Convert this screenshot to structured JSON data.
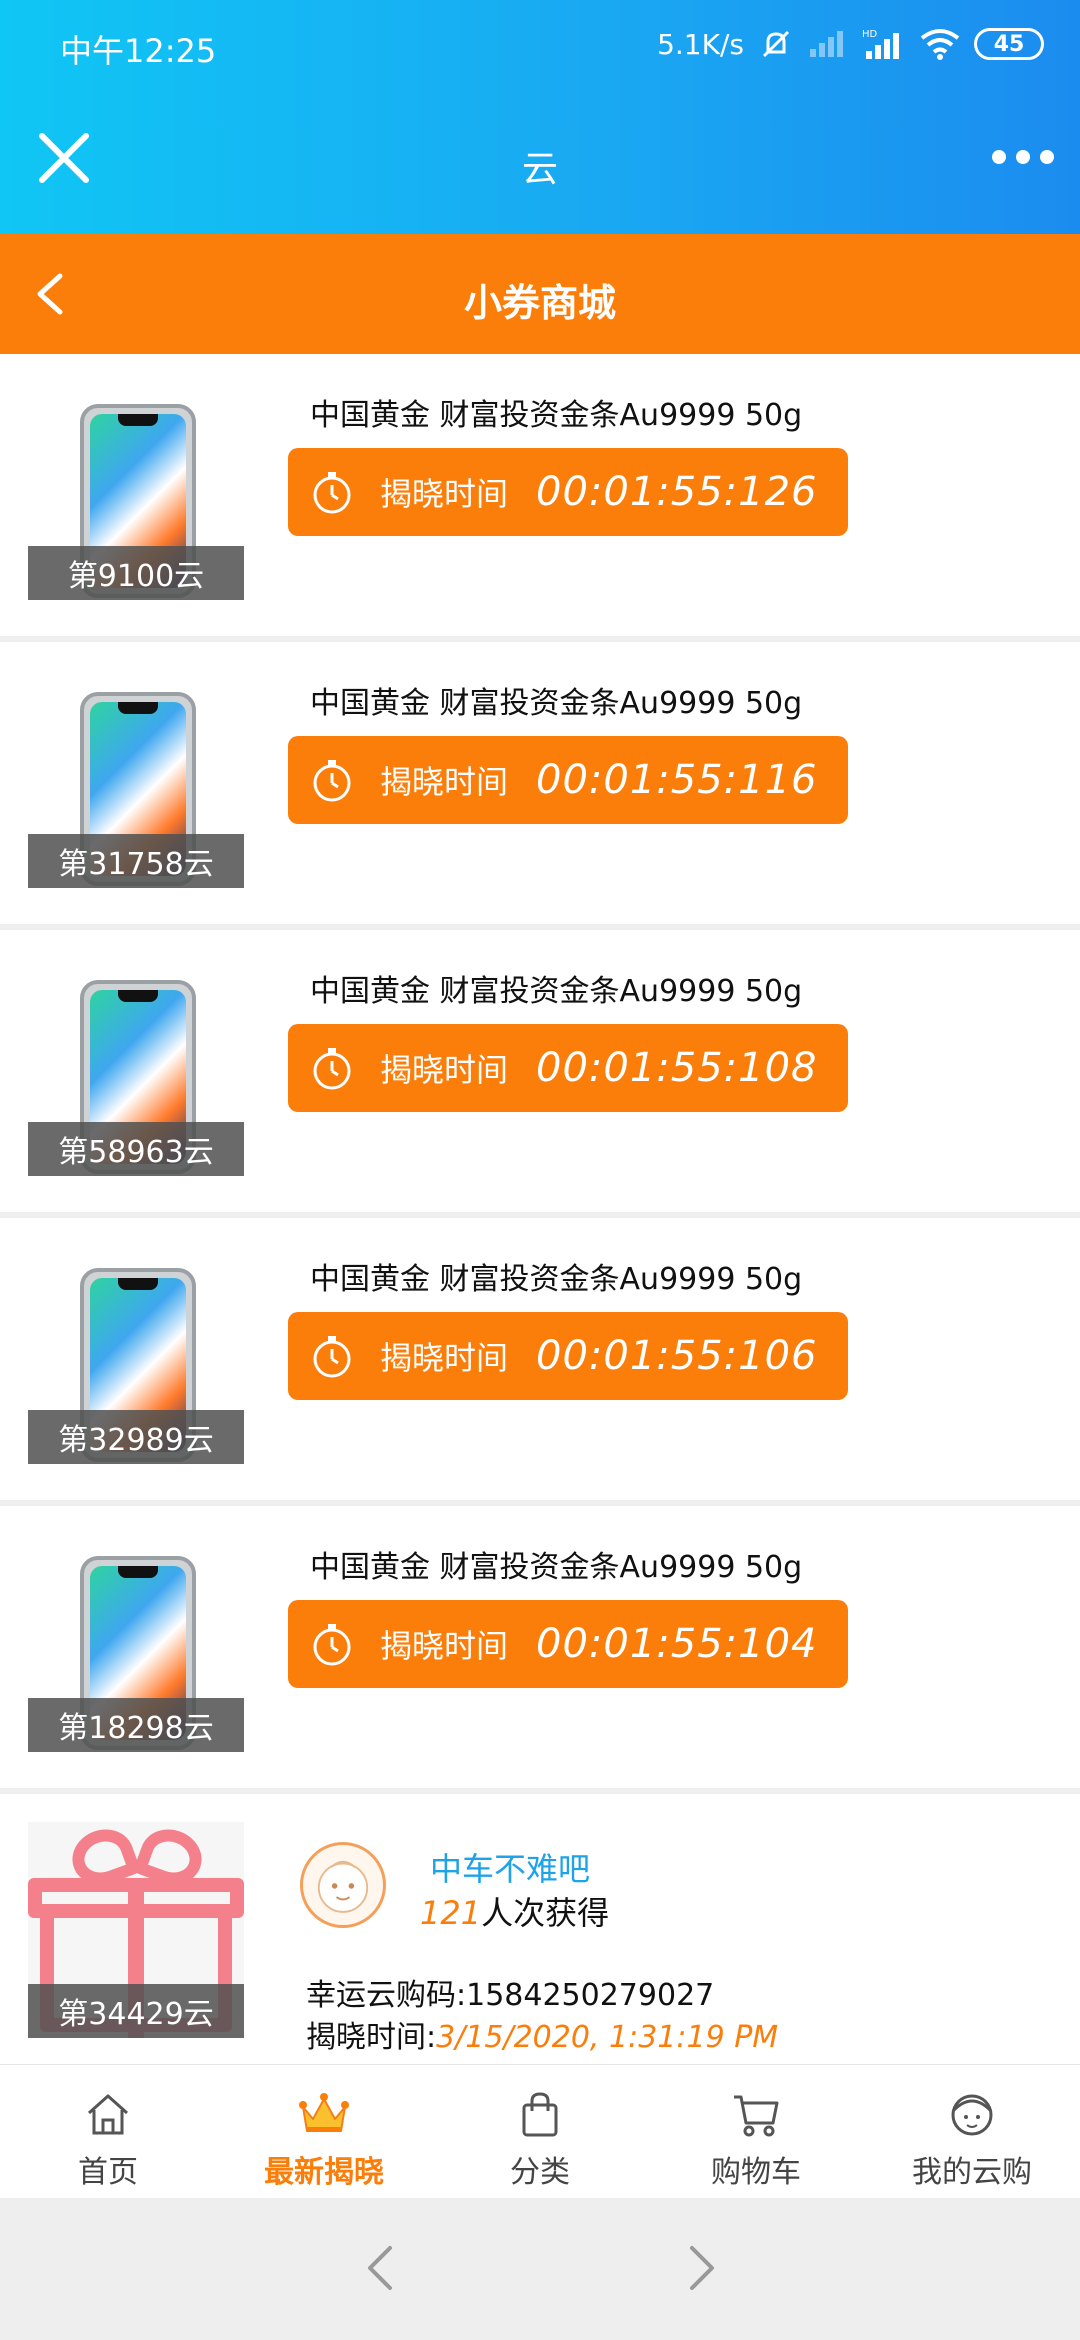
{
  "status_bar": {
    "time": "中午12:25",
    "network_speed": "5.1K/s",
    "battery": "45",
    "hd": "HD"
  },
  "titlebar": {
    "title": "云"
  },
  "header": {
    "title": "小券商城"
  },
  "countdown_label": "揭晓时间",
  "items": [
    {
      "round": "第9100云",
      "title": "中国黄金 财富投资金条Au9999 50g",
      "countdown": "00:01:55:126"
    },
    {
      "round": "第31758云",
      "title": "中国黄金 财富投资金条Au9999 50g",
      "countdown": "00:01:55:116"
    },
    {
      "round": "第58963云",
      "title": "中国黄金 财富投资金条Au9999 50g",
      "countdown": "00:01:55:108"
    },
    {
      "round": "第32989云",
      "title": "中国黄金 财富投资金条Au9999 50g",
      "countdown": "00:01:55:106"
    },
    {
      "round": "第18298云",
      "title": "中国黄金 财富投资金条Au9999 50g",
      "countdown": "00:01:55:104"
    }
  ],
  "revealed": {
    "round": "第34429云",
    "winner": "中车不难吧",
    "count": "121",
    "count_suffix": "人次获得",
    "lucky_code": "幸运云购码:1584250279027",
    "reveal_label": "揭晓时间:",
    "reveal_time": "3/15/2020, 1:31:19 PM"
  },
  "tabs": [
    {
      "label": "首页",
      "icon": "home-icon"
    },
    {
      "label": "最新揭晓",
      "icon": "crown-icon",
      "active": true
    },
    {
      "label": "分类",
      "icon": "bag-icon"
    },
    {
      "label": "购物车",
      "icon": "cart-icon"
    },
    {
      "label": "我的云购",
      "icon": "user-icon"
    }
  ],
  "colors": {
    "accent": "#fb7e0b",
    "topbar_start": "#10c6f4",
    "topbar_end": "#1b8cef",
    "winner_name": "#1ea3e8"
  }
}
